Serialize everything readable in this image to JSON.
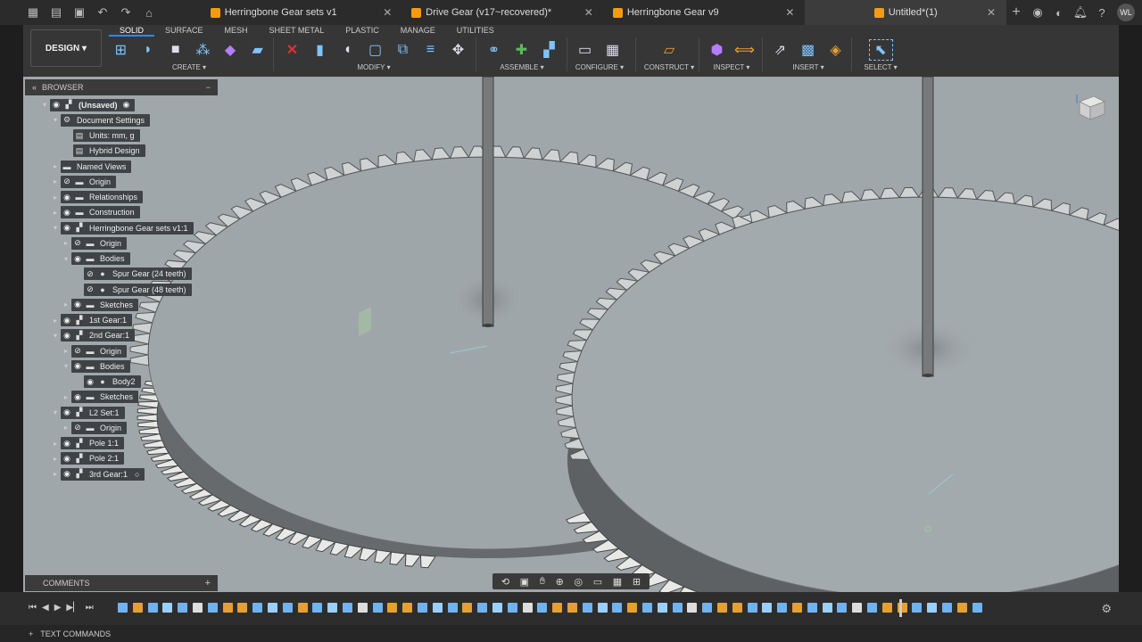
{
  "tabs": [
    {
      "label": "Herringbone Gear sets v1",
      "active": false
    },
    {
      "label": "Drive Gear (v17~recovered)*",
      "active": false
    },
    {
      "label": "Herringbone Gear v9",
      "active": false
    },
    {
      "label": "Untitled*(1)",
      "active": true
    }
  ],
  "user_initials": "WL",
  "workspace": {
    "label": "DESIGN ▾"
  },
  "ws_tabs": [
    {
      "label": "SOLID",
      "active": true
    },
    {
      "label": "SURFACE"
    },
    {
      "label": "MESH"
    },
    {
      "label": "SHEET METAL"
    },
    {
      "label": "PLASTIC"
    },
    {
      "label": "MANAGE"
    },
    {
      "label": "UTILITIES"
    }
  ],
  "tool_groups": {
    "create": "CREATE ▾",
    "modify": "MODIFY ▾",
    "assemble": "ASSEMBLE ▾",
    "configure": "CONFIGURE ▾",
    "construct": "CONSTRUCT ▾",
    "inspect": "INSPECT ▾",
    "insert": "INSERT ▾",
    "select": "SELECT ▾"
  },
  "browser": {
    "title": "BROWSER",
    "items": [
      {
        "label": "(Unsaved)"
      },
      {
        "label": "Document Settings"
      },
      {
        "label": "Units: mm, g"
      },
      {
        "label": "Hybrid Design"
      },
      {
        "label": "Named Views"
      },
      {
        "label": "Origin"
      },
      {
        "label": "Relationships"
      },
      {
        "label": "Construction"
      },
      {
        "label": "Herringbone Gear sets v1:1"
      },
      {
        "label": "Origin"
      },
      {
        "label": "Bodies"
      },
      {
        "label": "Spur Gear (24 teeth)"
      },
      {
        "label": "Spur Gear (48 teeth)"
      },
      {
        "label": "Sketches"
      },
      {
        "label": "1st Gear:1"
      },
      {
        "label": "2nd Gear:1"
      },
      {
        "label": "Origin"
      },
      {
        "label": "Bodies"
      },
      {
        "label": "Body2"
      },
      {
        "label": "Sketches"
      },
      {
        "label": "L2 Set:1"
      },
      {
        "label": "Origin"
      },
      {
        "label": "Pole 1:1"
      },
      {
        "label": "Pole 2:1"
      },
      {
        "label": "3rd Gear:1"
      }
    ]
  },
  "comments": {
    "label": "COMMENTS"
  },
  "text_commands": {
    "label": "TEXT COMMANDS"
  },
  "icons": {
    "accent": "#1e90ff",
    "viewport_bg": "#a0a7ab"
  }
}
